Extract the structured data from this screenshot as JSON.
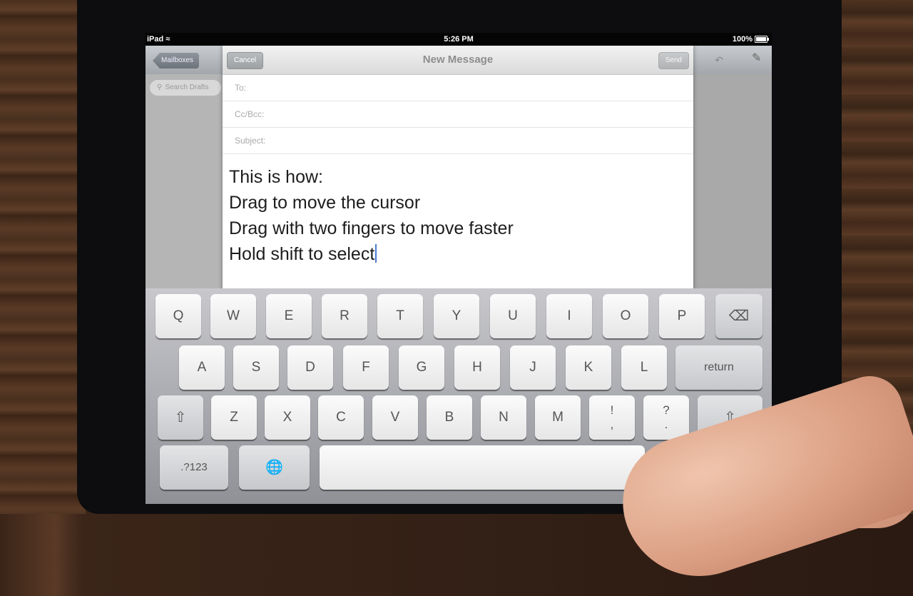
{
  "status": {
    "device": "iPad",
    "time": "5:26 PM",
    "battery": "100%",
    "battery_level": 1.0
  },
  "bg_app": {
    "back_button": "Mailboxes",
    "search_placeholder": "Search Drafts"
  },
  "compose": {
    "title": "New Message",
    "cancel": "Cancel",
    "send": "Send",
    "to_label": "To:",
    "cc_label": "Cc/Bcc:",
    "subject_label": "Subject:",
    "body_lines": [
      "This is how:",
      "Drag to move the cursor",
      "Drag with two fingers to move faster",
      "Hold shift to select"
    ]
  },
  "keyboard": {
    "row1": [
      "Q",
      "W",
      "E",
      "R",
      "T",
      "Y",
      "U",
      "I",
      "O",
      "P"
    ],
    "row2": [
      "A",
      "S",
      "D",
      "F",
      "G",
      "H",
      "J",
      "K",
      "L"
    ],
    "row3": [
      "Z",
      "X",
      "C",
      "V",
      "B",
      "N",
      "M"
    ],
    "return": "return",
    "numbers": ".?123",
    "punct1_top": "!",
    "punct1_bottom": ",",
    "punct2_top": "?",
    "punct2_bottom": "."
  },
  "icons": [
    "wifi-icon",
    "battery-icon",
    "search-icon",
    "compose-icon",
    "delete-icon",
    "shift-icon",
    "globe-icon",
    "hide-keyboard-icon"
  ]
}
